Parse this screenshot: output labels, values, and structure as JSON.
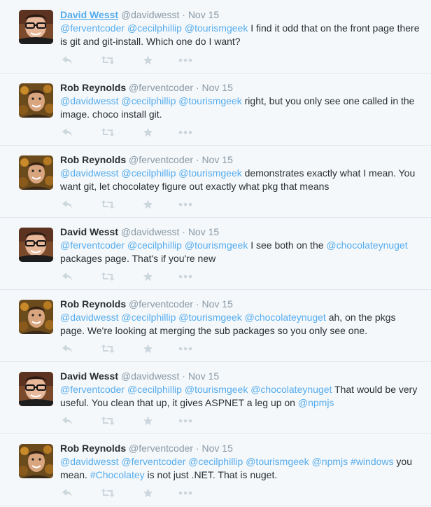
{
  "tweets": [
    {
      "avatar": "david",
      "name": "David Wesst",
      "handle": "@davidwesst",
      "time": "Nov 15",
      "active": true,
      "parts": [
        {
          "t": "@ferventcoder",
          "k": "mention"
        },
        {
          "t": " ",
          "k": "text"
        },
        {
          "t": "@cecilphillip",
          "k": "mention"
        },
        {
          "t": " ",
          "k": "text"
        },
        {
          "t": "@tourismgeek",
          "k": "mention"
        },
        {
          "t": " I find it odd that on the front page there is git and git-install. Which one do I want?",
          "k": "text"
        }
      ]
    },
    {
      "avatar": "rob",
      "name": "Rob Reynolds",
      "handle": "@ferventcoder",
      "time": "Nov 15",
      "parts": [
        {
          "t": "@davidwesst",
          "k": "mention"
        },
        {
          "t": " ",
          "k": "text"
        },
        {
          "t": "@cecilphillip",
          "k": "mention"
        },
        {
          "t": " ",
          "k": "text"
        },
        {
          "t": "@tourismgeek",
          "k": "mention"
        },
        {
          "t": " right, but you only see one called in the image. choco install git.",
          "k": "text"
        }
      ]
    },
    {
      "avatar": "rob",
      "name": "Rob Reynolds",
      "handle": "@ferventcoder",
      "time": "Nov 15",
      "parts": [
        {
          "t": "@davidwesst",
          "k": "mention"
        },
        {
          "t": " ",
          "k": "text"
        },
        {
          "t": "@cecilphillip",
          "k": "mention"
        },
        {
          "t": " ",
          "k": "text"
        },
        {
          "t": "@tourismgeek",
          "k": "mention"
        },
        {
          "t": " demonstrates exactly what I mean. You want git, let chocolatey figure out exactly what pkg that means",
          "k": "text"
        }
      ]
    },
    {
      "avatar": "david",
      "name": "David Wesst",
      "handle": "@davidwesst",
      "time": "Nov 15",
      "parts": [
        {
          "t": "@ferventcoder",
          "k": "mention"
        },
        {
          "t": " ",
          "k": "text"
        },
        {
          "t": "@cecilphillip",
          "k": "mention"
        },
        {
          "t": " ",
          "k": "text"
        },
        {
          "t": "@tourismgeek",
          "k": "mention"
        },
        {
          "t": " I see both on the ",
          "k": "text"
        },
        {
          "t": "@chocolateynuget",
          "k": "mention"
        },
        {
          "t": " packages page. That's if you're new",
          "k": "text"
        }
      ]
    },
    {
      "avatar": "rob",
      "name": "Rob Reynolds",
      "handle": "@ferventcoder",
      "time": "Nov 15",
      "parts": [
        {
          "t": "@davidwesst",
          "k": "mention"
        },
        {
          "t": " ",
          "k": "text"
        },
        {
          "t": "@cecilphillip",
          "k": "mention"
        },
        {
          "t": " ",
          "k": "text"
        },
        {
          "t": "@tourismgeek",
          "k": "mention"
        },
        {
          "t": " ",
          "k": "text"
        },
        {
          "t": "@chocolateynuget",
          "k": "mention"
        },
        {
          "t": " ah, on the pkgs page. We're looking at merging the sub packages so you only see one.",
          "k": "text"
        }
      ]
    },
    {
      "avatar": "david",
      "name": "David Wesst",
      "handle": "@davidwesst",
      "time": "Nov 15",
      "parts": [
        {
          "t": "@ferventcoder",
          "k": "mention"
        },
        {
          "t": " ",
          "k": "text"
        },
        {
          "t": "@cecilphillip",
          "k": "mention"
        },
        {
          "t": " ",
          "k": "text"
        },
        {
          "t": "@tourismgeek",
          "k": "mention"
        },
        {
          "t": " ",
          "k": "text"
        },
        {
          "t": "@chocolateynuget",
          "k": "mention"
        },
        {
          "t": " That would be very useful. You clean that up, it gives ASPNET a leg up on ",
          "k": "text"
        },
        {
          "t": "@npmjs",
          "k": "mention"
        }
      ]
    },
    {
      "avatar": "rob",
      "name": "Rob Reynolds",
      "handle": "@ferventcoder",
      "time": "Nov 15",
      "parts": [
        {
          "t": "@davidwesst",
          "k": "mention"
        },
        {
          "t": " ",
          "k": "text"
        },
        {
          "t": "@ferventcoder",
          "k": "mention"
        },
        {
          "t": " ",
          "k": "text"
        },
        {
          "t": "@cecilphillip",
          "k": "mention"
        },
        {
          "t": " ",
          "k": "text"
        },
        {
          "t": "@tourismgeek",
          "k": "mention"
        },
        {
          "t": " ",
          "k": "text"
        },
        {
          "t": "@npmjs",
          "k": "mention"
        },
        {
          "t": " ",
          "k": "text"
        },
        {
          "t": "#windows",
          "k": "hashtag"
        },
        {
          "t": " you mean. ",
          "k": "text"
        },
        {
          "t": "#Chocolatey",
          "k": "hashtag"
        },
        {
          "t": " is not just .NET. That is nuget.",
          "k": "text"
        }
      ]
    }
  ],
  "colors": {
    "link": "#55acee",
    "meta": "#8899a6",
    "text": "#292f33",
    "icon": "#ccd6dd",
    "background": "#f5f8fa",
    "divider": "#e1e8ed"
  },
  "icons": {
    "reply": "reply-icon",
    "retweet": "retweet-icon",
    "favorite": "star-icon",
    "more": "more-dots-icon"
  }
}
